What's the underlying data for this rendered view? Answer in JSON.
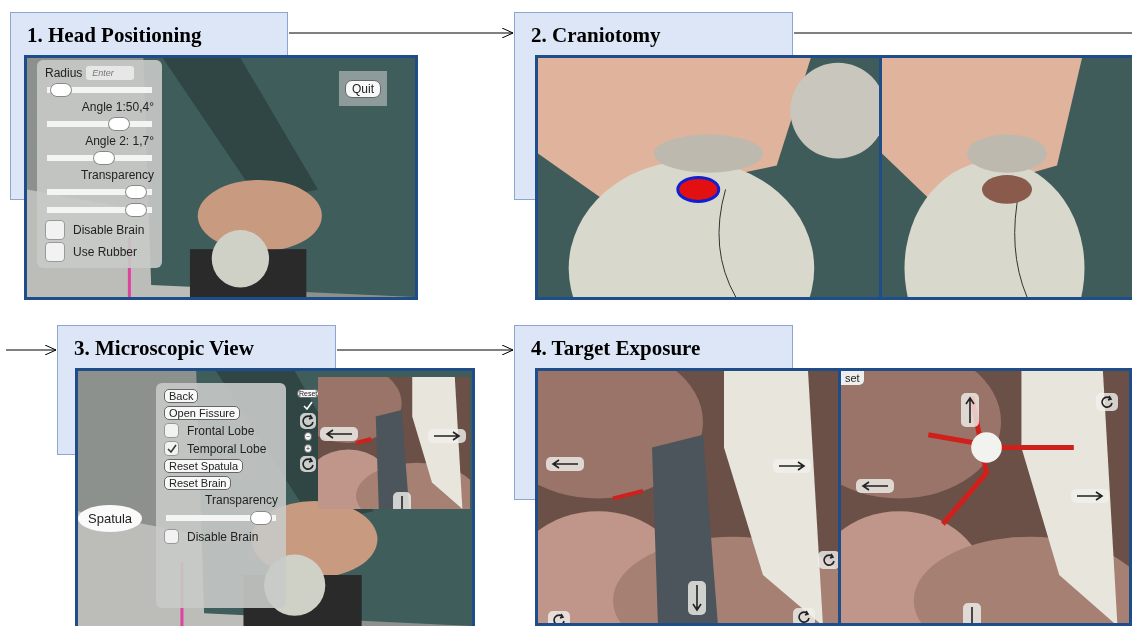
{
  "steps": [
    {
      "title": "1. Head Positioning",
      "screens": [
        {
          "kind": "picture",
          "panel": [
            {
              "kind": "field-row",
              "label": "Radius",
              "placeholder": "Enter"
            },
            {
              "kind": "slider",
              "level": 0.04
            },
            {
              "kind": "label",
              "text": "Angle 1:50,4°"
            },
            {
              "kind": "slider",
              "level": 0.74
            },
            {
              "kind": "label",
              "text": "Angle 2: 1,7°"
            },
            {
              "kind": "slider",
              "level": 0.55
            },
            {
              "kind": "label",
              "text": "Transparency"
            },
            {
              "kind": "slider",
              "level": 0.94
            },
            {
              "kind": "slider",
              "level": 0.94
            },
            {
              "kind": "checkbox",
              "label": "Disable Brain",
              "checked": false
            },
            {
              "kind": "checkbox",
              "label": "Use Rubber",
              "checked": false
            }
          ],
          "buttons": [
            {
              "label": "Quit"
            }
          ]
        }
      ]
    },
    {
      "title": "2. Craniotomy",
      "screens": [
        {
          "kind": "picture"
        },
        {
          "kind": "picture"
        }
      ]
    },
    {
      "title": "3. Microscopic View",
      "screens": [
        {
          "kind": "picture",
          "panel": [
            {
              "kind": "button",
              "label": "Back"
            },
            {
              "kind": "button",
              "label": "Open Fissure"
            },
            {
              "kind": "checkbox",
              "label": "Frontal Lobe",
              "checked": false
            },
            {
              "kind": "checkbox",
              "label": "Temporal Lobe",
              "checked": true
            },
            {
              "kind": "button",
              "label": "Reset Spatula"
            },
            {
              "kind": "button",
              "label": "Reset Brain"
            },
            {
              "kind": "label",
              "text": "Transparency"
            },
            {
              "kind": "slider",
              "level": 0.95
            },
            {
              "kind": "checkbox",
              "label": "Disable Brain",
              "checked": false
            }
          ],
          "tag": "Spatula",
          "toolbar": [
            {
              "kind": "button",
              "label": "Reset"
            },
            {
              "kind": "check"
            },
            {
              "kind": "rotate"
            },
            {
              "kind": "button",
              "label": "−"
            },
            {
              "kind": "button",
              "label": "+"
            },
            {
              "kind": "rotate"
            }
          ]
        }
      ]
    },
    {
      "title": "4. Target Exposure",
      "screens": [
        {
          "kind": "picture"
        },
        {
          "kind": "picture",
          "buttons": [
            {
              "label": "set"
            }
          ]
        }
      ]
    }
  ]
}
